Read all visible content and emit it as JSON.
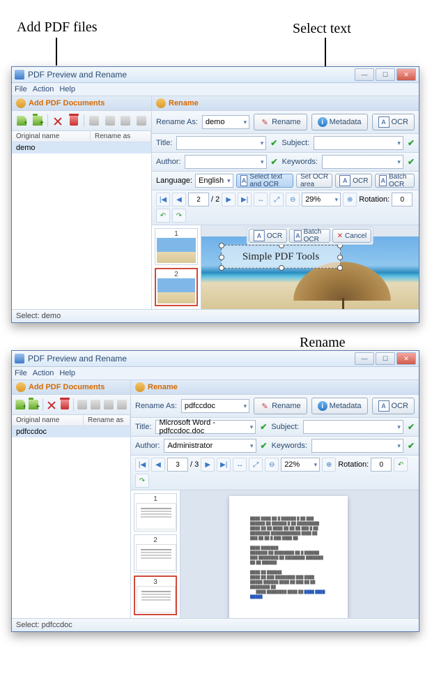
{
  "annotations": {
    "add_pdf": "Add PDF files",
    "select_text": "Select text",
    "rename": "Rename"
  },
  "window1": {
    "title": "PDF Preview and Rename",
    "menu": {
      "file": "File",
      "action": "Action",
      "help": "Help"
    },
    "left": {
      "header": "Add PDF Documents",
      "cols": {
        "orig": "Original name",
        "ren": "Rename as"
      },
      "rows": [
        {
          "orig": "demo",
          "ren": ""
        }
      ]
    },
    "right": {
      "header": "Rename",
      "rename_as_label": "Rename As:",
      "rename_as_value": "demo",
      "rename_btn": "Rename",
      "metadata_btn": "Metadata",
      "ocr_btn": "OCR",
      "title_label": "Title:",
      "title_value": "",
      "subject_label": "Subject:",
      "subject_value": "",
      "author_label": "Author:",
      "author_value": "",
      "keywords_label": "Keywords:",
      "keywords_value": "",
      "language_label": "Language:",
      "language_value": "English",
      "select_ocr_btn": "Select text and OCR",
      "set_ocr_area_btn": "Set OCR area",
      "ocr_small_btn": "OCR",
      "batch_ocr_btn": "Batch OCR",
      "page_current": "2",
      "page_sep": "/",
      "page_total": "2",
      "zoom": "29%",
      "rotation_label": "Rotation:",
      "rotation_value": "0",
      "ocr_toolbar": {
        "ocr": "OCR",
        "batch": "Batch OCR",
        "cancel": "Cancel"
      },
      "selected_text": "Simple PDF Tools",
      "thumbs": [
        "1",
        "2"
      ]
    },
    "status": "Select: demo"
  },
  "window2": {
    "title": "PDF Preview and Rename",
    "menu": {
      "file": "File",
      "action": "Action",
      "help": "Help"
    },
    "left": {
      "header": "Add PDF Documents",
      "cols": {
        "orig": "Original name",
        "ren": "Rename as"
      },
      "rows": [
        {
          "orig": "pdfccdoc",
          "ren": ""
        }
      ]
    },
    "right": {
      "header": "Rename",
      "rename_as_label": "Rename As:",
      "rename_as_value": "pdfccdoc",
      "rename_btn": "Rename",
      "metadata_btn": "Metadata",
      "ocr_btn": "OCR",
      "title_label": "Title:",
      "title_value": "Microsoft Word - pdfccdoc.doc",
      "subject_label": "Subject:",
      "subject_value": "",
      "author_label": "Author:",
      "author_value": "Administrator",
      "keywords_label": "Keywords:",
      "keywords_value": "",
      "page_current": "3",
      "page_sep": "/",
      "page_total": "3",
      "zoom": "22%",
      "rotation_label": "Rotation:",
      "rotation_value": "0",
      "thumbs": [
        "1",
        "2",
        "3"
      ]
    },
    "status": "Select: pdfccdoc"
  }
}
